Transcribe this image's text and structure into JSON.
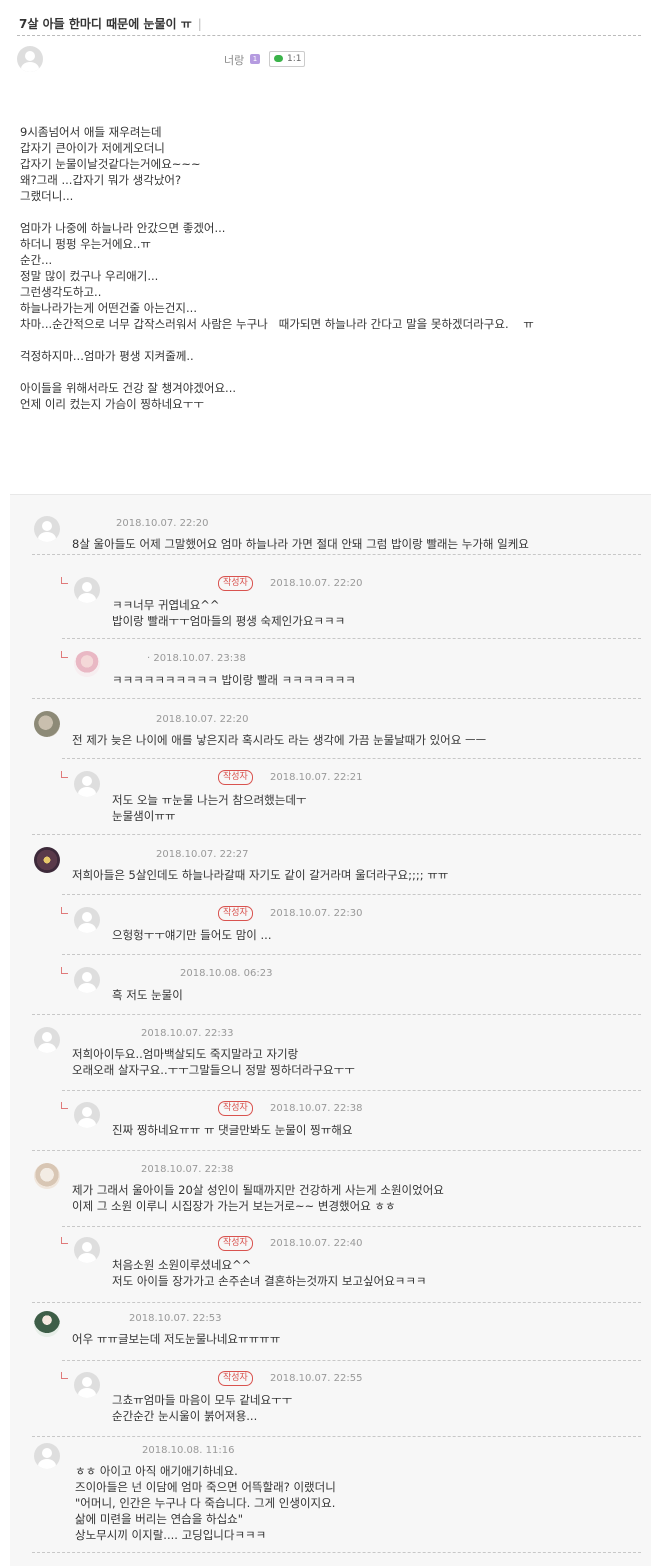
{
  "post": {
    "title": "7살 아들 한마디 때문에 눈물이 ㅠ",
    "title_separator": "|",
    "author": "너랑",
    "level_badge": "1",
    "chat_label": "1:1",
    "body": [
      "9시좀넘어서 애들 재우려는데",
      "갑자기 큰아이가 저에게오더니",
      "갑자기 눈물이날것같다는거에요~~~",
      "왜?그래 ...갑자기 뭐가 생각났어?",
      "그랬더니...",
      "",
      "엄마가 나중에 하늘나라 안갔으면 좋겠어...",
      "하더니 펑펑 우는거에요..ㅠ",
      "순간...",
      "정말 많이 컸구나 우리애기...",
      "그런생각도하고..",
      "하늘나라가는게 어떤건줄 아는건지...",
      "차마...순간적으로 너무 갑작스러워서 사람은 누구나   때가되면 하늘나라 간다고 말을 못하겠더라구요.    ㅠ",
      "",
      "걱정하지마...엄마가 평생 지켜줄께..",
      "",
      "아이들을 위해서라도 건강 잘 챙겨야겠어요...",
      "언제 이리 컸는지 가슴이 찡하네요ㅜㅜ"
    ]
  },
  "comments": [
    {
      "date": "2018.10.07. 22:20",
      "lines": [
        "8살 울아들도 어제 그말했어요 엄마 하늘나라 가면 절대 안돼 그럼 밥이랑 빨래는 누가해 일케요"
      ]
    },
    {
      "reply": true,
      "writer": "작성자",
      "date": "2018.10.07. 22:20",
      "lines": [
        "ㅋㅋ너무 귀엽네요^^",
        "밥이랑 빨래ㅜㅜ엄마들의 평생 숙제인가요ㅋㅋㅋ"
      ]
    },
    {
      "reply": true,
      "prefix": "·",
      "date": "2018.10.07. 23:38",
      "lines": [
        "ㅋㅋㅋㅋㅋㅋㅋㅋㅋㅋ 밥이랑 빨래 ㅋㅋㅋㅋㅋㅋㅋ"
      ]
    },
    {
      "date": "2018.10.07. 22:20",
      "lines": [
        "전 제가 늦은 나이에 애를 낳은지라 혹시라도 라는 생각에 가끔 눈물날때가 있어요 ㅡㅡ"
      ]
    },
    {
      "reply": true,
      "writer": "작성자",
      "date": "2018.10.07. 22:21",
      "lines": [
        "저도 오늘 ㅠ눈물 나는거 참으려했는데ㅜ",
        "눈물샘이ㅠㅠ"
      ]
    },
    {
      "date": "2018.10.07. 22:27",
      "lines": [
        "저희아들은 5살인데도 하늘나라갈때 자기도 같이 갈거라며 울더라구요;;;; ㅠㅠ"
      ]
    },
    {
      "reply": true,
      "writer": "작성자",
      "date": "2018.10.07. 22:30",
      "lines": [
        "으헝헝ㅜㅜ얘기만 들어도 맘이 ..."
      ]
    },
    {
      "reply": true,
      "date": "2018.10.08. 06:23",
      "lines": [
        "흑 저도 눈물이"
      ]
    },
    {
      "date": "2018.10.07. 22:33",
      "lines": [
        "저희아이두요..엄마백살되도 죽지말라고 자기랑",
        "오래오래 살자구요..ㅜㅜ그말들으니 정말 찡하더라구요ㅜㅜ"
      ]
    },
    {
      "reply": true,
      "writer": "작성자",
      "date": "2018.10.07. 22:38",
      "lines": [
        "진짜 찡하네요ㅠㅠ ㅠ 댓글만봐도 눈물이 찡ㅠ해요"
      ]
    },
    {
      "date": "2018.10.07. 22:38",
      "lines": [
        "제가 그래서 울아이들 20살 성인이 될때까지만 건강하게 사는게 소원이었어요",
        "이제 그 소원 이루니 시집장가 가는거 보는거로~~ 변경했어요 ㅎㅎ"
      ]
    },
    {
      "reply": true,
      "writer": "작성자",
      "date": "2018.10.07. 22:40",
      "lines": [
        "처음소원 소원이루셨네요^^",
        "저도 아이들 장가가고 손주손녀 결혼하는것까지 보고싶어요ㅋㅋㅋ"
      ]
    },
    {
      "date": "2018.10.07. 22:53",
      "lines": [
        "어우 ㅠㅠ글보는데 저도눈물나네요ㅠㅠㅠㅠ"
      ]
    },
    {
      "reply": true,
      "writer": "작성자",
      "date": "2018.10.07. 22:55",
      "lines": [
        "그쵸ㅠ엄마들 마음이 모두 같네요ㅜㅜ",
        "순간순간 눈시울이 붉어져용..."
      ]
    },
    {
      "date": "2018.10.08. 11:16",
      "lines": [
        "ㅎㅎ 아이고 아직 애기애기하네요.",
        "즈이아들은 넌 이담에 엄마 죽으면 어뜩할래? 이랬더니",
        "\"어머니, 인간은 누구나 다 죽습니다. 그게 인생이지요.",
        "삶에 미련을 버리는 연습을 하십쇼\"",
        "상노무시끼 이지랄.... 고딩입니다ㅋㅋㅋ"
      ]
    }
  ]
}
